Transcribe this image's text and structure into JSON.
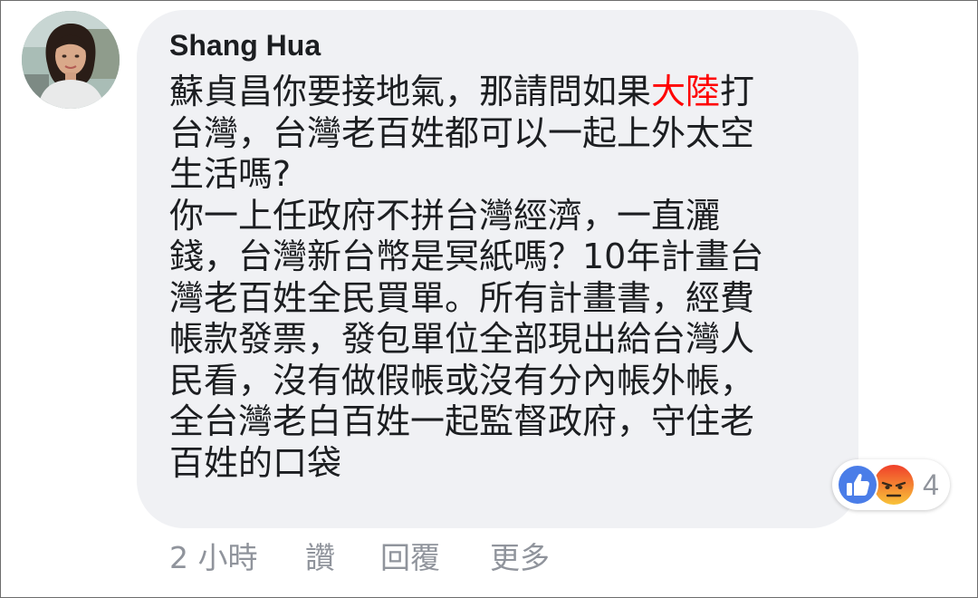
{
  "comment": {
    "author": "Shang Hua",
    "lines": [
      {
        "before": "蘇貞昌你要接地氣，那請問如果",
        "highlight": "大陸",
        "after": "打"
      },
      {
        "text": "台灣，台灣老百姓都可以一起上外太空"
      },
      {
        "text": "生活嗎?"
      },
      {
        "text": "你一上任政府不拼台灣經濟，一直灑"
      },
      {
        "text": "錢，台灣新台幣是冥紙嗎？10年計畫台"
      },
      {
        "text": "灣老百姓全民買單。所有計畫書，經費"
      },
      {
        "text": "帳款發票，發包單位全部現出給台灣人"
      },
      {
        "text": "民看，沒有做假帳或沒有分內帳外帳，"
      },
      {
        "text": "全台灣老白百姓一起監督政府，守住老"
      },
      {
        "text": "百姓的口袋"
      }
    ],
    "highlight_color": "#ff0000"
  },
  "reactions": {
    "icons": [
      "like-icon",
      "angry-icon"
    ],
    "count": "4",
    "like_color": "#4a7de8",
    "angry_color": "#f26a1f"
  },
  "actions": {
    "time": "2 小時",
    "like_label": "讚",
    "reply_label": "回覆",
    "more_label": "更多"
  },
  "colors": {
    "bubble": "#f0f1f4",
    "text": "#1c1e21",
    "muted": "#90949c"
  }
}
